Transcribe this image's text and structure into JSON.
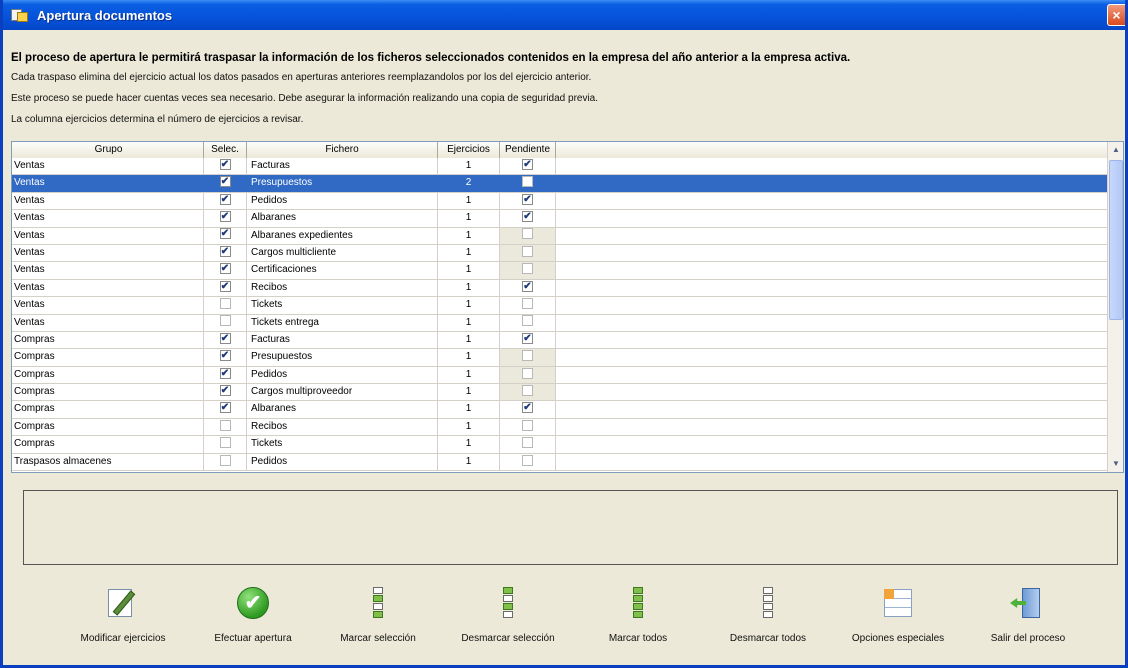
{
  "window": {
    "title": "Apertura documentos",
    "close_label": "×"
  },
  "info": {
    "heading": "El proceso de apertura le permitirá traspasar la información de los ficheros seleccionados contenidos en la empresa del año anterior a la empresa activa.",
    "line1": "Cada traspaso elimina del ejercicio actual los datos pasados en aperturas anteriores reemplazandolos por los del ejercicio anterior.",
    "line2": "Este proceso se puede hacer cuentas veces sea necesario. Debe asegurar la información realizando una copia de seguridad previa.",
    "line3": "La columna ejercicios determina el número de ejercicios a revisar."
  },
  "grid": {
    "headers": {
      "grupo": "Grupo",
      "selec": "Selec.",
      "fichero": "Fichero",
      "ejercicios": "Ejercicios",
      "pendiente": "Pendiente"
    },
    "rows": [
      {
        "grupo": "Ventas",
        "selec": true,
        "fichero": "Facturas",
        "ejercicios": "1",
        "pendiente": true,
        "shade": false
      },
      {
        "grupo": "Ventas",
        "selec": true,
        "fichero": "Presupuestos",
        "ejercicios": "2",
        "pendiente": false,
        "shade": false,
        "selected": true
      },
      {
        "grupo": "Ventas",
        "selec": true,
        "fichero": "Pedidos",
        "ejercicios": "1",
        "pendiente": true,
        "shade": false
      },
      {
        "grupo": "Ventas",
        "selec": true,
        "fichero": "Albaranes",
        "ejercicios": "1",
        "pendiente": true,
        "shade": false
      },
      {
        "grupo": "Ventas",
        "selec": true,
        "fichero": "Albaranes expedientes",
        "ejercicios": "1",
        "pendiente": false,
        "shade": true
      },
      {
        "grupo": "Ventas",
        "selec": true,
        "fichero": "Cargos multicliente",
        "ejercicios": "1",
        "pendiente": false,
        "shade": true
      },
      {
        "grupo": "Ventas",
        "selec": true,
        "fichero": "Certificaciones",
        "ejercicios": "1",
        "pendiente": false,
        "shade": true
      },
      {
        "grupo": "Ventas",
        "selec": true,
        "fichero": "Recibos",
        "ejercicios": "1",
        "pendiente": true,
        "shade": false
      },
      {
        "grupo": "Ventas",
        "selec": false,
        "fichero": "Tickets",
        "ejercicios": "1",
        "pendiente": false,
        "shade": false
      },
      {
        "grupo": "Ventas",
        "selec": false,
        "fichero": "Tickets entrega",
        "ejercicios": "1",
        "pendiente": false,
        "shade": false
      },
      {
        "grupo": "Compras",
        "selec": true,
        "fichero": "Facturas",
        "ejercicios": "1",
        "pendiente": true,
        "shade": false
      },
      {
        "grupo": "Compras",
        "selec": true,
        "fichero": "Presupuestos",
        "ejercicios": "1",
        "pendiente": false,
        "shade": true
      },
      {
        "grupo": "Compras",
        "selec": true,
        "fichero": "Pedidos",
        "ejercicios": "1",
        "pendiente": false,
        "shade": true
      },
      {
        "grupo": "Compras",
        "selec": true,
        "fichero": "Cargos multiproveedor",
        "ejercicios": "1",
        "pendiente": false,
        "shade": true
      },
      {
        "grupo": "Compras",
        "selec": true,
        "fichero": "Albaranes",
        "ejercicios": "1",
        "pendiente": true,
        "shade": false
      },
      {
        "grupo": "Compras",
        "selec": false,
        "fichero": "Recibos",
        "ejercicios": "1",
        "pendiente": false,
        "shade": false
      },
      {
        "grupo": "Compras",
        "selec": false,
        "fichero": "Tickets",
        "ejercicios": "1",
        "pendiente": false,
        "shade": false
      },
      {
        "grupo": "Traspasos almacenes",
        "selec": false,
        "fichero": "Pedidos",
        "ejercicios": "1",
        "pendiente": false,
        "shade": false
      }
    ]
  },
  "toolbar": {
    "modificar": "Modificar ejercicios",
    "efectuar": "Efectuar apertura",
    "marcar_sel": "Marcar selección",
    "desmarcar_sel": "Desmarcar selección",
    "marcar_todos": "Marcar todos",
    "desmarcar_todos": "Desmarcar todos",
    "opciones": "Opciones especiales",
    "salir": "Salir del proceso"
  },
  "glyphs": {
    "check": "✔",
    "ok": "✔",
    "scroll_up": "▲",
    "scroll_down": "▼"
  },
  "colors": {
    "titlebar": "#0553da",
    "selection": "#316ac5",
    "window_bg": "#ece9d8"
  }
}
